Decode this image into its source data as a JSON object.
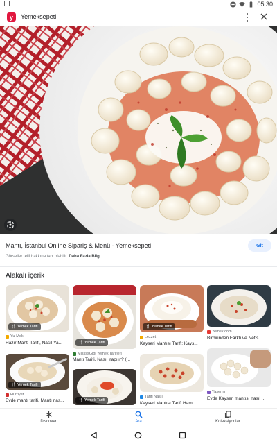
{
  "status_bar": {
    "time": "05:30"
  },
  "app": {
    "logo_letter": "y",
    "title": "Yemeksepeti"
  },
  "result": {
    "title": "Mantı, İstanbul Online Sipariş & Menü - Yemeksepeti",
    "copyright_text": "Görseller telif hakkına tabi olabilir.",
    "more_info_label": "Daha Fazla Bilgi",
    "visit_label": "Git"
  },
  "related": {
    "heading": "Alakalı içerik",
    "badge_text": "Yemek Tarifi",
    "cards": [
      {
        "source": "Yu-Mek",
        "caption": "Hazır Mantı Tarifi, Nasıl Ya..."
      },
      {
        "source": "Evde mantı tarifi, Mantı nas...",
        "caption": "Evde mantı tarifi, Mantı nas..."
      },
      {
        "source": "MissssGibi Yemek Tarifleri",
        "caption": "Mantı Tarifi, Nasıl Yapılır? (..."
      },
      {
        "source": "Lezzet",
        "caption": "Kayseri Mantısı Tarifi: Kays..."
      },
      {
        "source": "Tarifi Nasıl",
        "caption": "Kayseri Mantısı Tarifi Ham..."
      },
      {
        "source": "Yemek.com",
        "caption": "Birbirinden Farklı ve Nefis ..."
      },
      {
        "source": "Yasemin",
        "caption": "Evde Kayseri mantısı nasıl ..."
      },
      {
        "source": "Hürriyet",
        "caption": "Evde mantı tarifi, Mantı nas..."
      }
    ]
  },
  "bottom_nav": {
    "discover": "Discover",
    "search": "Ara",
    "collections": "Koleksiyonlar"
  },
  "colors": {
    "brand": "#e1173f",
    "accent": "#1a73e8"
  }
}
